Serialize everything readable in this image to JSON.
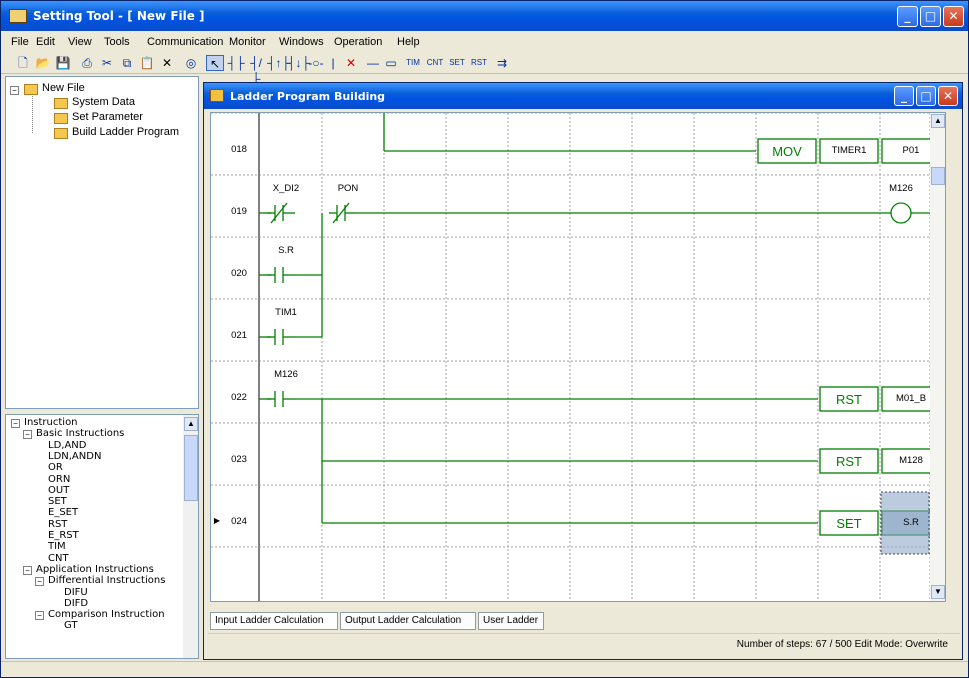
{
  "window": {
    "title": "Setting Tool - [ New File ]"
  },
  "menu": [
    "File",
    "Edit",
    "View",
    "Tools",
    "Communication",
    "Monitor",
    "Windows",
    "Operation",
    "Help"
  ],
  "toolbar": {
    "extra_labels": [
      "TIM",
      "CNT",
      "SET",
      "RST"
    ]
  },
  "project_tree": {
    "root": "New File",
    "children": [
      "System Data",
      "Set Parameter",
      "Build Ladder Program"
    ]
  },
  "instruction_tree": {
    "items": [
      {
        "label": "Instruction",
        "level": 0
      },
      {
        "label": "Basic Instructions",
        "level": 1
      },
      {
        "label": "LD,AND",
        "level": 2
      },
      {
        "label": "LDN,ANDN",
        "level": 2
      },
      {
        "label": "OR",
        "level": 2
      },
      {
        "label": "ORN",
        "level": 2
      },
      {
        "label": "OUT",
        "level": 2
      },
      {
        "label": "SET",
        "level": 2
      },
      {
        "label": "E_SET",
        "level": 2
      },
      {
        "label": "RST",
        "level": 2
      },
      {
        "label": "E_RST",
        "level": 2
      },
      {
        "label": "TIM",
        "level": 2
      },
      {
        "label": "CNT",
        "level": 2
      },
      {
        "label": "Application Instructions",
        "level": 1
      },
      {
        "label": "Differential Instructions",
        "level": 2
      },
      {
        "label": "DIFU",
        "level": 3
      },
      {
        "label": "DIFD",
        "level": 3
      },
      {
        "label": "Comparison Instruction",
        "level": 2
      },
      {
        "label": "GT",
        "level": 3
      }
    ]
  },
  "ladder_window": {
    "title": "Ladder Program Building",
    "rungs": [
      {
        "no": "018",
        "contacts": [],
        "box": {
          "op": "MOV",
          "args": [
            "TIMER1",
            "P01"
          ]
        }
      },
      {
        "no": "019",
        "contacts": [
          "X_DI2",
          "PON"
        ],
        "coil": "M126"
      },
      {
        "no": "020",
        "contacts": [
          "S.R"
        ]
      },
      {
        "no": "021",
        "contacts": [
          "TIM1"
        ]
      },
      {
        "no": "022",
        "contacts": [
          "M126"
        ],
        "box": {
          "op": "RST",
          "args": [
            "M01_B"
          ]
        }
      },
      {
        "no": "023",
        "contacts": [],
        "box": {
          "op": "RST",
          "args": [
            "M128"
          ]
        }
      },
      {
        "no": "024",
        "contacts": [],
        "box": {
          "op": "SET",
          "args": [
            "S.R"
          ]
        }
      }
    ],
    "current_row": "024",
    "tabs": [
      "Input Ladder Calculation",
      "Output Ladder Calculation",
      "User Ladder"
    ],
    "status": "Number of steps: 67 / 500 Edit Mode: Overwrite"
  }
}
